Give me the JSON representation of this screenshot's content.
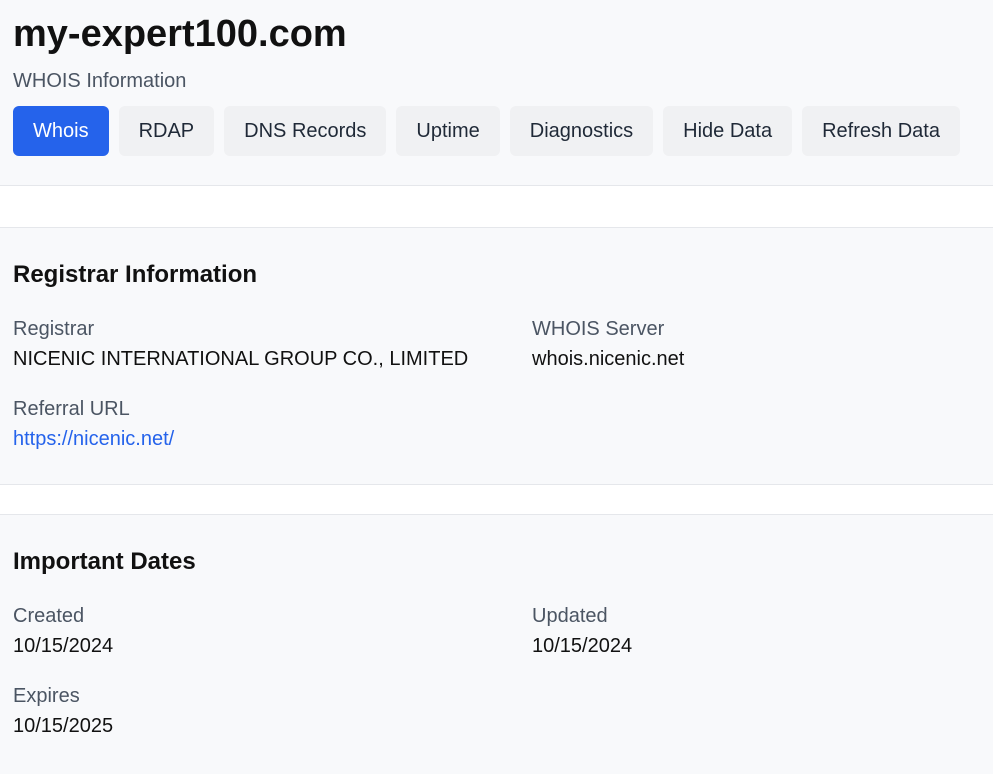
{
  "header": {
    "domain": "my-expert100.com",
    "subtitle": "WHOIS Information"
  },
  "tabs": [
    {
      "label": "Whois",
      "active": true
    },
    {
      "label": "RDAP",
      "active": false
    },
    {
      "label": "DNS Records",
      "active": false
    },
    {
      "label": "Uptime",
      "active": false
    },
    {
      "label": "Diagnostics",
      "active": false
    },
    {
      "label": "Hide Data",
      "active": false
    },
    {
      "label": "Refresh Data",
      "active": false
    }
  ],
  "registrar_section": {
    "title": "Registrar Information",
    "registrar": {
      "label": "Registrar",
      "value": "NICENIC INTERNATIONAL GROUP CO., LIMITED"
    },
    "whois_server": {
      "label": "WHOIS Server",
      "value": "whois.nicenic.net"
    },
    "referral_url": {
      "label": "Referral URL",
      "value": "https://nicenic.net/"
    }
  },
  "dates_section": {
    "title": "Important Dates",
    "created": {
      "label": "Created",
      "value": "10/15/2024"
    },
    "updated": {
      "label": "Updated",
      "value": "10/15/2024"
    },
    "expires": {
      "label": "Expires",
      "value": "10/15/2025"
    }
  },
  "colors": {
    "accent": "#2563eb",
    "tab_bg": "#f0f1f3",
    "panel_bg": "#f8f9fb",
    "muted_text": "#4b5563"
  }
}
